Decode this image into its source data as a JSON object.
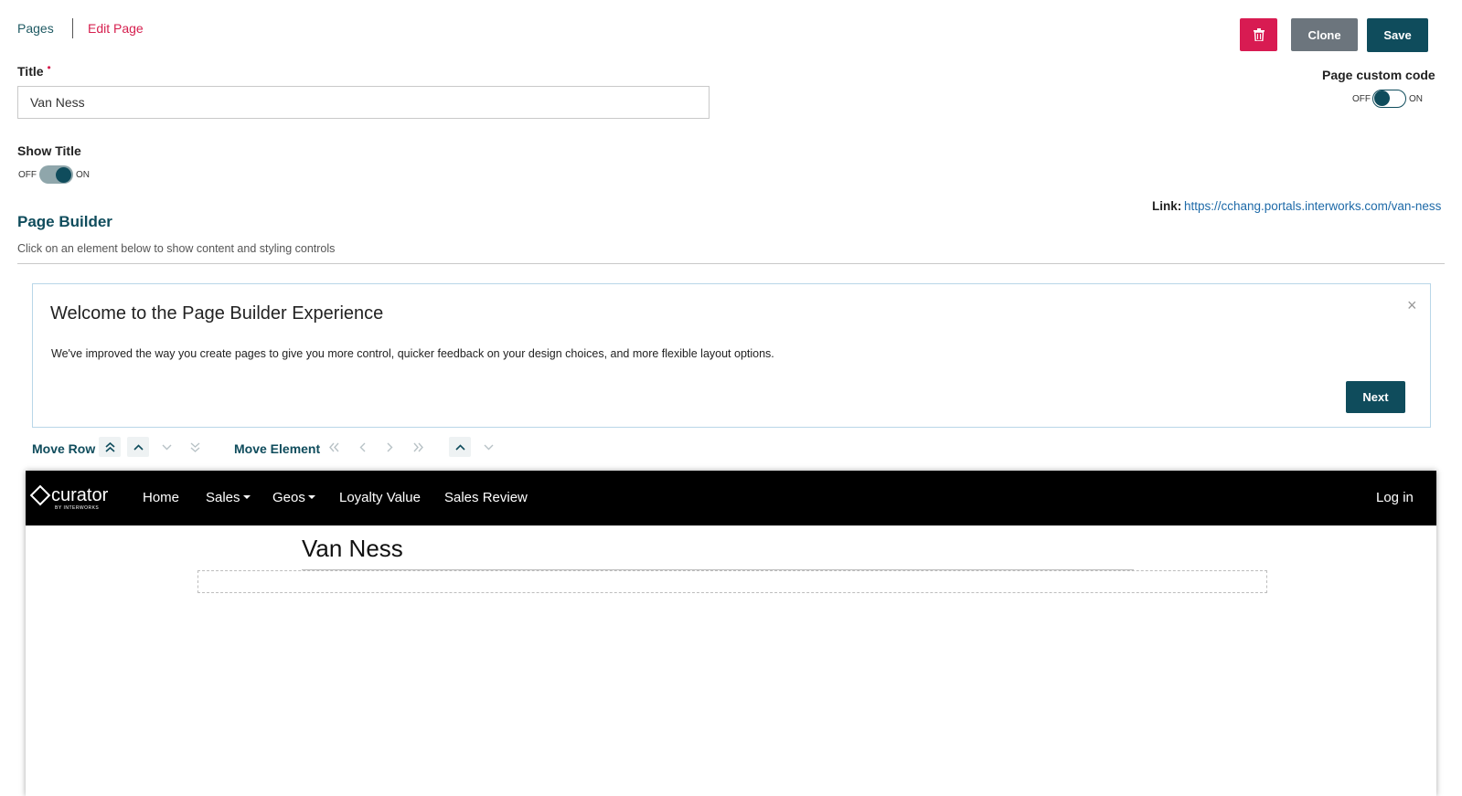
{
  "breadcrumb": {
    "pages": "Pages",
    "edit": "Edit Page"
  },
  "actions": {
    "delete_icon": "trash-icon",
    "clone": "Clone",
    "save": "Save"
  },
  "title_field": {
    "label": "Title",
    "required_mark": "•",
    "value": "Van Ness"
  },
  "show_title": {
    "label": "Show Title",
    "off": "OFF",
    "on": "ON",
    "state": "on"
  },
  "custom_code": {
    "label": "Page custom code",
    "off": "OFF",
    "on": "ON",
    "state": "off"
  },
  "page_builder": {
    "heading": "Page Builder",
    "subtext": "Click on an element below to show content and styling controls"
  },
  "link": {
    "label": "Link:",
    "url": "https://cchang.portals.interworks.com/van-ness"
  },
  "welcome": {
    "title": "Welcome to the Page Builder Experience",
    "body": "We've improved the way you create pages to give you more control, quicker feedback on your design choices, and more flexible layout options.",
    "close": "×",
    "next": "Next"
  },
  "move_row": {
    "label": "Move Row"
  },
  "move_element": {
    "label": "Move Element"
  },
  "preview": {
    "logo_text": "curator",
    "logo_sub": "BY INTERWORKS",
    "nav": [
      "Home",
      "Sales",
      "Geos",
      "Loyalty Value",
      "Sales Review"
    ],
    "login": "Log in",
    "page_title": "Van Ness"
  },
  "colors": {
    "brand": "#0f4c5c",
    "danger": "#d81b52",
    "accent_text": "#d6204f"
  }
}
